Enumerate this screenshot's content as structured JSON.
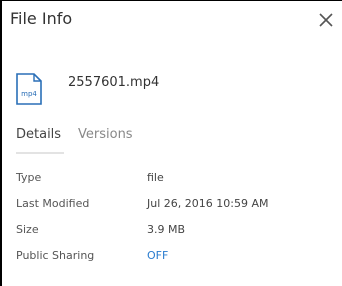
{
  "panel": {
    "title": "File Info",
    "close_icon": "close-icon"
  },
  "file": {
    "name": "2557601.mp4",
    "icon": "mp4-file-icon",
    "icon_text": "mp4"
  },
  "tabs": [
    {
      "label": "Details",
      "active": true
    },
    {
      "label": "Versions",
      "active": false
    }
  ],
  "properties": [
    {
      "label": "Type",
      "value": "file"
    },
    {
      "label": "Last Modified",
      "value": "Jul 26, 2016 10:59 AM"
    },
    {
      "label": "Size",
      "value": "3.9 MB"
    },
    {
      "label": "Public Sharing",
      "value": "OFF"
    }
  ],
  "colors": {
    "link": "#2a7ccf",
    "icon_stroke": "#2a6fb7"
  }
}
